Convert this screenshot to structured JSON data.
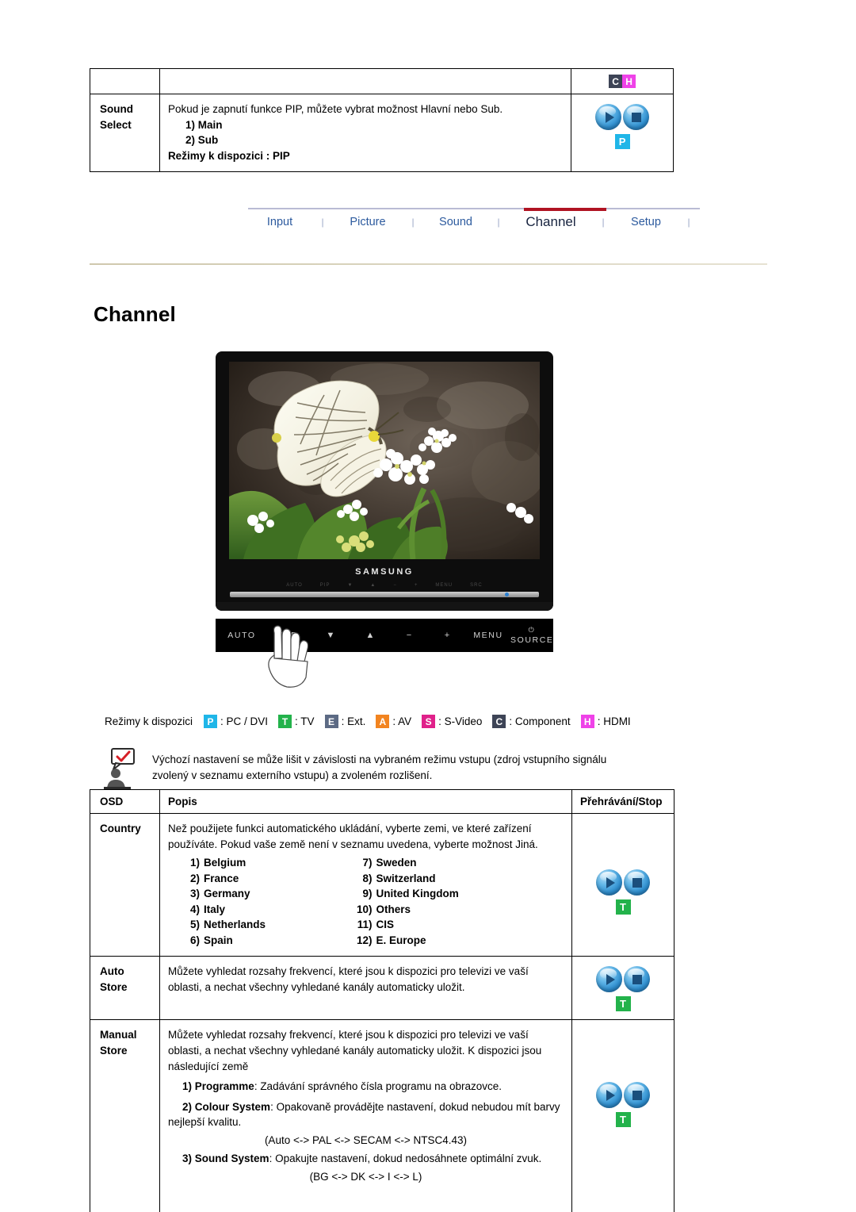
{
  "top_section": {
    "badge_icons": [
      {
        "letter": "C",
        "name": "component-badge",
        "color": "#3d4456"
      },
      {
        "letter": "H",
        "name": "hdmi-badge",
        "color": "#ef42e8"
      }
    ],
    "row": {
      "osd_label_line1": "Sound",
      "osd_label_line2": "Select",
      "desc_intro": "Pokud je zapnutí funkce PIP, můžete vybrat možnost Hlavní nebo Sub.",
      "options": [
        "1) Main",
        "2) Sub"
      ],
      "modes_line": "Režimy k dispozici : PIP",
      "mode_badge": "P"
    }
  },
  "nav": {
    "items": [
      {
        "label": "Input",
        "active": false
      },
      {
        "label": "Picture",
        "active": false
      },
      {
        "label": "Sound",
        "active": false
      },
      {
        "label": "Channel",
        "active": true
      },
      {
        "label": "Setup",
        "active": false
      }
    ],
    "separator": "|",
    "active_color": "#b01322",
    "link_color": "#2c5a9e"
  },
  "heading": "Channel",
  "monitor": {
    "brand": "SAMSUNG",
    "controls": [
      "AUTO",
      "PIP",
      "▼",
      "▲",
      "−",
      "+",
      "MENU",
      "SOURCE"
    ],
    "screen_alt": "butterfly on white flowers"
  },
  "legend": {
    "label": "Režimy k dispozici",
    "entries": [
      {
        "letter": "P",
        "text": ": PC / DVI",
        "color": "#1fb6e8"
      },
      {
        "letter": "T",
        "text": ": TV",
        "color": "#23b24b"
      },
      {
        "letter": "E",
        "text": ": Ext.",
        "color": "#5c6a84"
      },
      {
        "letter": "A",
        "text": ": AV",
        "color": "#f28420"
      },
      {
        "letter": "S",
        "text": ": S-Video",
        "color": "#e0218a"
      },
      {
        "letter": "C",
        "text": ": Component",
        "color": "#3d4456"
      },
      {
        "letter": "H",
        "text": ": HDMI",
        "color": "#ef42e8"
      }
    ]
  },
  "note": {
    "line1": "Výchozí nastavení se může lišit v závislosti na vybraném režimu vstupu (zdroj vstupního signálu",
    "line2": "zvolený v seznamu externího vstupu) a zvoleném rozlišení."
  },
  "main_table": {
    "headers": {
      "osd": "OSD",
      "popis": "Popis",
      "play_stop": "Přehrávání/Stop"
    },
    "rows": [
      {
        "osd": "Country",
        "desc": "Než použijete funkci automatického ukládání, vyberte zemi, ve které zařízení používáte. Pokud vaše země není v seznamu uvedena, vyberte možnost Jiná.",
        "countries_left": [
          {
            "num": "1)",
            "name": "Belgium"
          },
          {
            "num": "2)",
            "name": "France"
          },
          {
            "num": "3)",
            "name": "Germany"
          },
          {
            "num": "4)",
            "name": "Italy"
          },
          {
            "num": "5)",
            "name": "Netherlands"
          },
          {
            "num": "6)",
            "name": "Spain"
          }
        ],
        "countries_right": [
          {
            "num": "7)",
            "name": "Sweden"
          },
          {
            "num": "8)",
            "name": "Switzerland"
          },
          {
            "num": "9)",
            "name": "United Kingdom"
          },
          {
            "num": "10)",
            "name": "Others"
          },
          {
            "num": "11)",
            "name": "CIS"
          },
          {
            "num": "12)",
            "name": "E. Europe"
          }
        ],
        "mode_badge": "T"
      },
      {
        "osd_line1": "Auto",
        "osd_line2": "Store",
        "desc": "Můžete vyhledat rozsahy frekvencí, které jsou k dispozici pro televizi ve vaší oblasti, a nechat všechny vyhledané kanály automaticky uložit.",
        "mode_badge": "T"
      },
      {
        "osd_line1": "Manual",
        "osd_line2": "Store",
        "desc": "Můžete vyhledat rozsahy frekvencí, které jsou k dispozici pro televizi ve vaší oblasti, a nechat všechny vyhledané kanály automaticky uložit. K dispozici jsou následující země",
        "sub_items": [
          {
            "num": "1)",
            "term": "Programme",
            "text": ": Zadávání správného čísla programu na obrazovce."
          },
          {
            "num": "2)",
            "term": "Colour System",
            "text": ": Opakovaně provádějte nastavení, dokud nebudou mít barvy nejlepší kvalitu."
          },
          {
            "num": "3)",
            "term": "Sound System",
            "text": ": Opakujte nastavení, dokud nedosáhnete optimální zvuk."
          }
        ],
        "center_line_1": "(Auto <-> PAL <-> SECAM <-> NTSC4.43)",
        "center_line_2": "(BG <-> DK <-> I <-> L)",
        "mode_badge": "T"
      }
    ]
  }
}
